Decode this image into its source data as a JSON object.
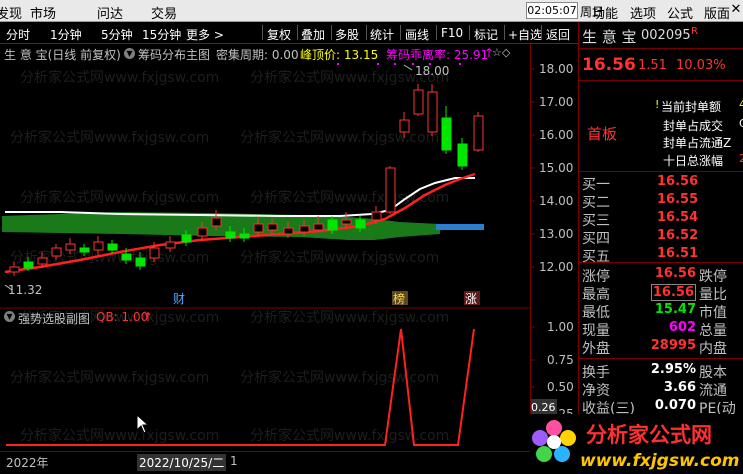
{
  "menu": {
    "left_partial": "发现",
    "items": [
      "市场",
      "问达",
      "交易"
    ],
    "clock": "02:05:07",
    "weekday": "周日",
    "right_items": [
      "功能",
      "选项",
      "公式",
      "版面"
    ]
  },
  "toolbar": {
    "periods": [
      "分时",
      "1分钟",
      "5分钟",
      "15分钟",
      "更多 >"
    ],
    "actions": [
      "复权",
      "叠加",
      "多股",
      "统计",
      "画线",
      "F10",
      "标记",
      "+自选",
      "返回"
    ]
  },
  "chart_header": {
    "title": "生 意 宝(日线 前复权)",
    "indicator": "筹码分布主图",
    "density_label": "密集周期: 0.00",
    "peak_label": "峰顶价: 13.15",
    "deviation_label": "筹码乖离率: 25.91",
    "arrow": "↑"
  },
  "price_axis": {
    "ticks": [
      "18.00",
      "17.00",
      "16.00",
      "15.00",
      "14.00",
      "13.00",
      "12.00"
    ],
    "sub_ticks": [
      "1.00",
      "0.75",
      "0.50",
      "0.25"
    ],
    "sub_bottom_value": "0.26"
  },
  "chart_annotations": {
    "high_mark": "18.00",
    "low_mark": "11.32",
    "markers": [
      "财",
      "榜",
      "涨"
    ]
  },
  "sub_header": {
    "title": "强势选股副图",
    "indicator": "QB: 1.00",
    "arrow": "↑"
  },
  "datebar": {
    "year": "2022年",
    "cursor_date": "2022/10/25/二",
    "extra": "1"
  },
  "watermark": {
    "text": "分析家公式网www.fxjgsw.com",
    "logo_cn": "分析家公式网",
    "logo_url": "www.fxjgsw.com"
  },
  "panel": {
    "name": "生 意 宝",
    "code": "002095",
    "badge": "R",
    "price": "16.56",
    "change": "1.51",
    "change_pct": "10.03%",
    "limit_items": [
      "当前封单额",
      "封单占成交",
      "封单占流通Z",
      "十日总涨幅"
    ],
    "limit_values": [
      "4",
      "C",
      "",
      "2"
    ],
    "board_label": "首板",
    "bids": [
      {
        "label": "买一",
        "price": "16.56",
        "vol": "0"
      },
      {
        "label": "买二",
        "price": "16.55",
        "vol": "0"
      },
      {
        "label": "买三",
        "price": "16.54",
        "vol": "0"
      },
      {
        "label": "买四",
        "price": "16.52",
        "vol": "0"
      },
      {
        "label": "买五",
        "price": "16.51",
        "vol": "0"
      }
    ],
    "stats": [
      {
        "label": "涨停",
        "value": "16.56",
        "label2": "跌停"
      },
      {
        "label": "最高",
        "value": "16.56",
        "label2": "量比"
      },
      {
        "label": "最低",
        "value": "15.47",
        "label2": "市值"
      },
      {
        "label": "现量",
        "value": "602",
        "label2": "总量"
      },
      {
        "label": "外盘",
        "value": "28995",
        "label2": "内盘"
      }
    ],
    "stats2": [
      {
        "label": "换手",
        "value": "2.95%",
        "label2": "股本"
      },
      {
        "label": "净资",
        "value": "3.66",
        "label2": "流通"
      },
      {
        "label": "收益(三)",
        "value": "0.070",
        "label2": "PE(动"
      }
    ]
  },
  "colors": {
    "up": "#ff3232",
    "down": "#00e600",
    "accent": "#ffff00",
    "border": "#7a0000",
    "chip_band": "#1a7a1a"
  }
}
